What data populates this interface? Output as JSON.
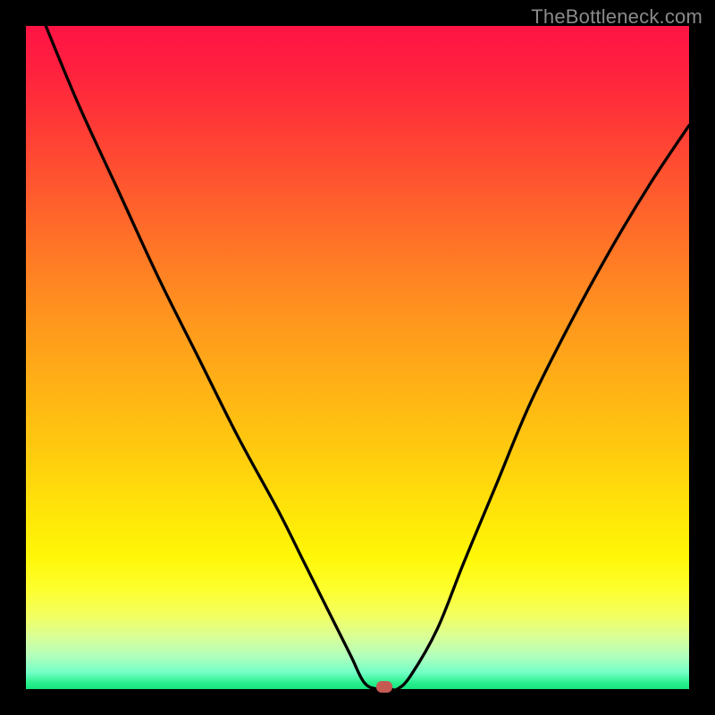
{
  "watermark": "TheBottleneck.com",
  "colors": {
    "frame": "#000000",
    "curve": "#000000",
    "marker": "#c65a53",
    "gradient_top": "#ff1445",
    "gradient_bottom": "#15e47f"
  },
  "chart_data": {
    "type": "line",
    "title": "",
    "xlabel": "",
    "ylabel": "",
    "xlim": [
      0,
      100
    ],
    "ylim": [
      0,
      100
    ],
    "x": [
      3,
      8,
      14,
      20,
      26,
      32,
      38,
      42,
      46,
      49,
      51,
      53,
      55,
      56,
      58,
      62,
      66,
      71,
      76,
      82,
      88,
      94,
      100
    ],
    "y": [
      100,
      88,
      75,
      62,
      50,
      38,
      27,
      19,
      11,
      5,
      1,
      0,
      0,
      0,
      2,
      9,
      19,
      31,
      43,
      55,
      66,
      76,
      85
    ],
    "marker": {
      "x": 54,
      "y": 0
    },
    "notes": "V-shaped bottleneck curve; gradient background encodes severity (red high, green low)."
  }
}
